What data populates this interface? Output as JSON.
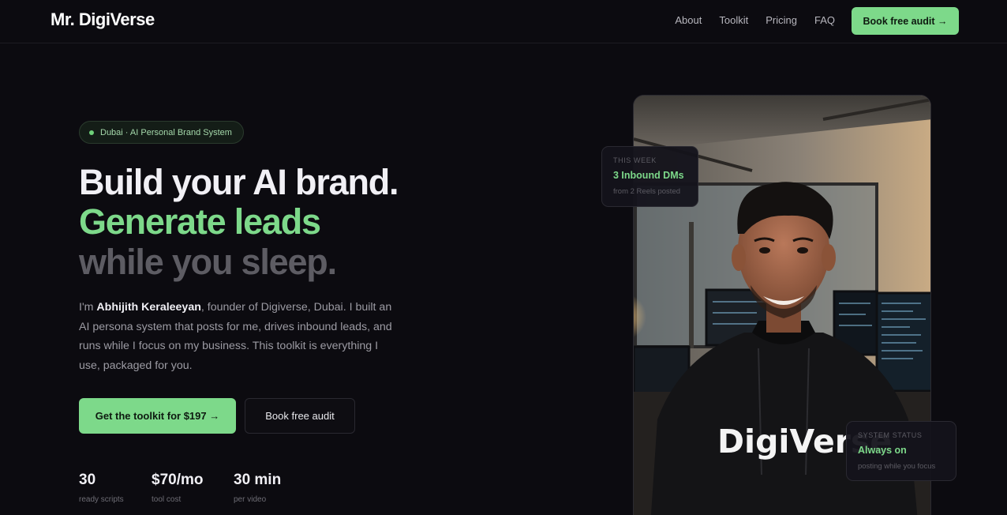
{
  "nav": {
    "logo_main": "Mr. DigiVerse",
    "links": [
      "About",
      "Toolkit",
      "Pricing",
      "FAQ"
    ],
    "cta_label": "Book free audit →"
  },
  "hero": {
    "badge": "Dubai · AI Personal Brand System",
    "headline_1": "Build your AI brand.",
    "headline_2": "Generate leads",
    "headline_3": "while you sleep.",
    "intro_prefix": "I'm ",
    "intro_name": "Abhijith Keraleeyan",
    "intro_rest": ", founder of Digiverse, Dubai. I built an AI persona system that posts for me, drives inbound leads, and runs while I focus on my business. This toolkit is everything I use, packaged for you.",
    "primary_cta": "Get the toolkit for $197 →",
    "secondary_cta": "Book free audit",
    "stats": [
      {
        "value": "30",
        "label": "ready scripts"
      },
      {
        "value": "$70/mo",
        "label": "tool cost"
      },
      {
        "value": "30 min",
        "label": "per video"
      }
    ]
  },
  "cards": {
    "week": {
      "kicker": "THIS WEEK",
      "title": "3 Inbound DMs",
      "sub": "from 2 Reels posted"
    },
    "status": {
      "kicker": "SYSTEM STATUS",
      "title": "Always on",
      "sub": "posting while you focus"
    }
  },
  "photo": {
    "hoodie_text": "DigiVerse"
  },
  "colors": {
    "accent": "#7dd98a",
    "background": "#0c0b10"
  }
}
